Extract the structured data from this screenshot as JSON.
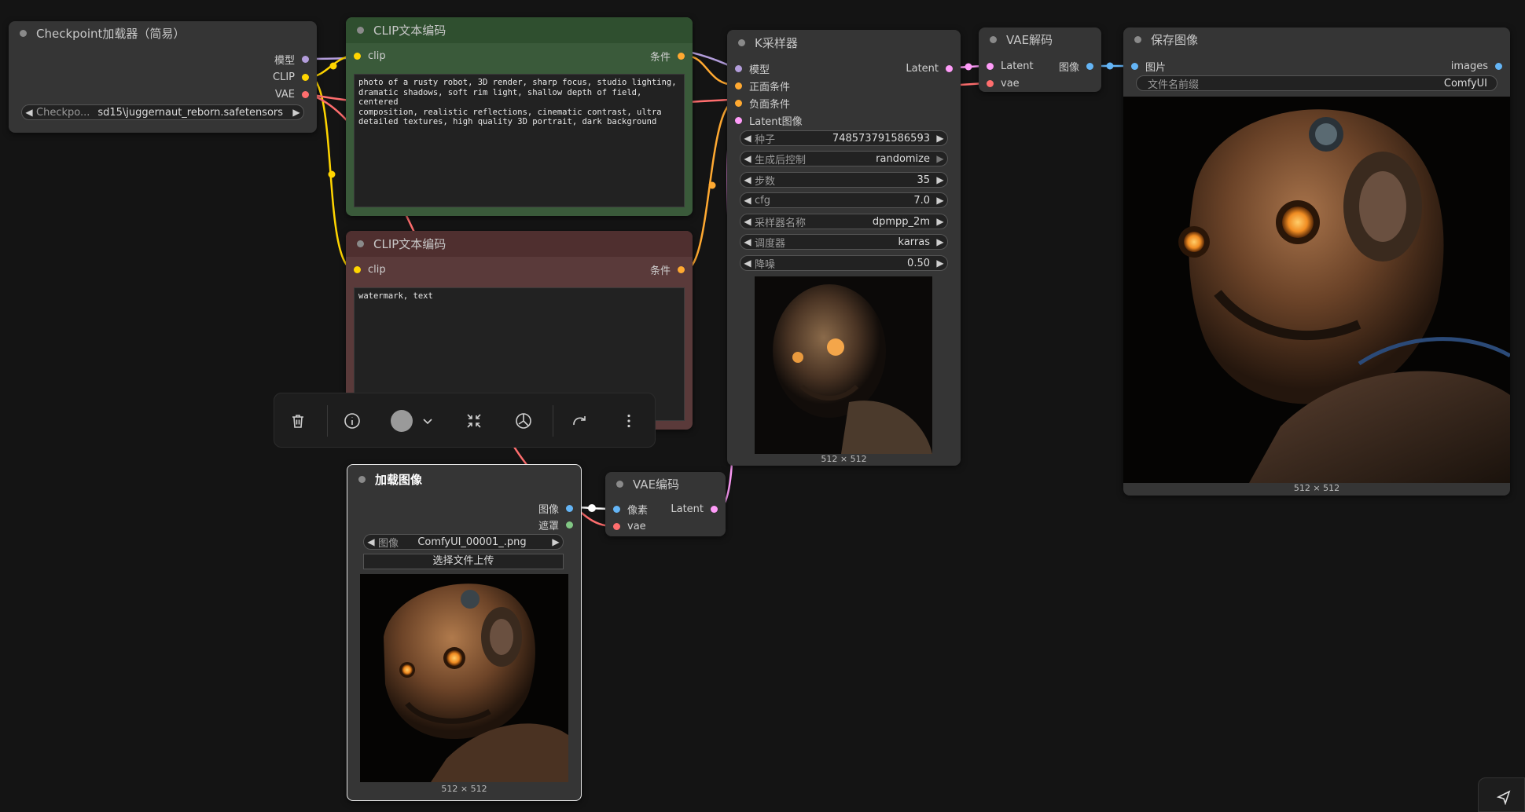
{
  "nodes": {
    "checkpoint": {
      "title": "Checkpoint加载器（简易）",
      "outputs": [
        "模型",
        "CLIP",
        "VAE"
      ],
      "widget": {
        "label": "Checkpo...",
        "value": "sd15\\juggernaut_reborn.safetensors"
      }
    },
    "clip_pos": {
      "title": "CLIP文本编码",
      "input": "clip",
      "output": "条件",
      "text": "photo of a rusty robot, 3D render, sharp focus, studio lighting,\ndramatic shadows, soft rim light, shallow depth of field, centered\ncomposition, realistic reflections, cinematic contrast, ultra\ndetailed textures, high quality 3D portrait, dark background"
    },
    "clip_neg": {
      "title": "CLIP文本编码",
      "input": "clip",
      "output": "条件",
      "text": "watermark, text"
    },
    "ksampler": {
      "title": "K采样器",
      "inputs": [
        "模型",
        "正面条件",
        "负面条件",
        "Latent图像"
      ],
      "output": "Latent",
      "widgets": [
        {
          "label": "种子",
          "value": "748573791586593"
        },
        {
          "label": "生成后控制",
          "value": "randomize"
        },
        {
          "label": "步数",
          "value": "35"
        },
        {
          "label": "cfg",
          "value": "7.0"
        },
        {
          "label": "采样器名称",
          "value": "dpmpp_2m"
        },
        {
          "label": "调度器",
          "value": "karras"
        },
        {
          "label": "降噪",
          "value": "0.50"
        }
      ],
      "preview_size": "512 × 512"
    },
    "vae_decode": {
      "title": "VAE解码",
      "inputs": [
        "Latent",
        "vae"
      ],
      "output": "图像"
    },
    "save_image": {
      "title": "保存图像",
      "input": "图片",
      "output": "images",
      "widget": {
        "label": "文件名前缀",
        "value": "ComfyUI"
      },
      "preview_size": "512 × 512"
    },
    "load_image": {
      "title": "加载图像",
      "outputs": [
        "图像",
        "遮罩"
      ],
      "widget": {
        "label": "图像",
        "value": "ComfyUI_00001_.png"
      },
      "upload_label": "选择文件上传",
      "preview_size": "512 × 512"
    },
    "vae_encode": {
      "title": "VAE编码",
      "inputs": [
        "像素",
        "vae"
      ],
      "output": "Latent"
    }
  },
  "toolbar": {
    "buttons": [
      "delete-icon",
      "info-icon",
      "color-picker",
      "collapse-icon",
      "bypass-icon",
      "redo-icon",
      "more-icon"
    ]
  },
  "colors": {
    "model": "#b39ddb",
    "clip": "#ffd500",
    "vae": "#ff6e6e",
    "conditioning": "#ffa931",
    "latent": "#ff9cf9",
    "image": "#64b5f6",
    "mask": "#81c784",
    "node_green": "#2f4f2f",
    "node_red": "#4f2f2f"
  }
}
